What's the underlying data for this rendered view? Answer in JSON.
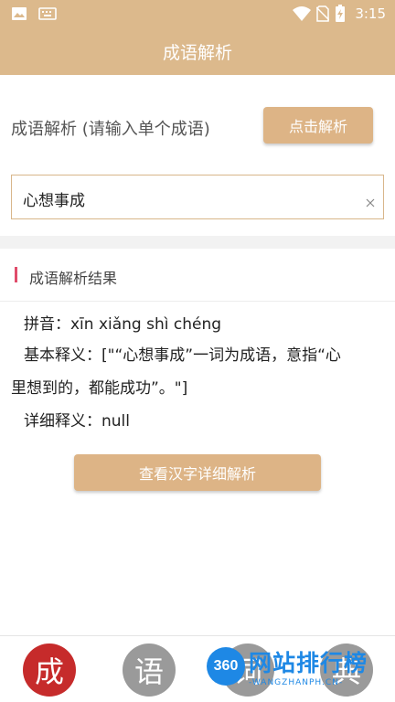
{
  "status_bar": {
    "time": "3:15",
    "icons": [
      "image-icon",
      "keyboard-icon",
      "wifi-icon",
      "no-sim-icon",
      "battery-charging-icon"
    ]
  },
  "app_bar": {
    "title": "成语解析"
  },
  "input_section": {
    "label": "成语解析 (请输入单个成语)",
    "parse_button": "点击解析",
    "input_value": "心想事成"
  },
  "result_section": {
    "title": "成语解析结果",
    "accent_color": "#e04c6b",
    "pinyin_line": "拼音：xīn xiǎng shì chéng",
    "basic_meaning_line1": "基本释义：[\"“心想事成”一词为成语，意指“心",
    "basic_meaning_line2": "里想到的，都能成功”。\"]",
    "detail_meaning_line": "详细释义：null",
    "detail_button": "查看汉字详细解析"
  },
  "bottom_nav": {
    "items": [
      "成",
      "语",
      "词",
      "典"
    ],
    "active_color": "#c62b2b",
    "inactive_color": "#9a9a9a"
  },
  "watermark": {
    "logo": "360",
    "text": "网站排行榜",
    "sub": "-WANGZHANPH.CN-"
  },
  "colors": {
    "primary": "#dcb98c",
    "button": "#ddb486"
  }
}
